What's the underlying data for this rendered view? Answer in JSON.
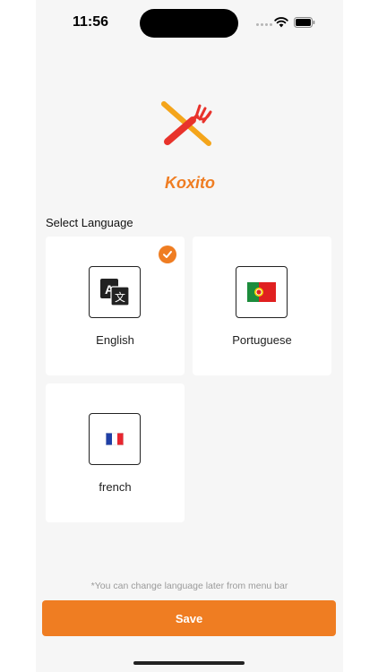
{
  "status_bar": {
    "time": "11:56"
  },
  "brand": {
    "name": "Koxito"
  },
  "section": {
    "title": "Select Language"
  },
  "languages": [
    {
      "label": "English",
      "icon": "translate-icon",
      "selected": true
    },
    {
      "label": "Portuguese",
      "icon": "portugal-flag-icon",
      "selected": false
    },
    {
      "label": "french",
      "icon": "france-flag-icon",
      "selected": false
    }
  ],
  "hint": "*You can change language later from menu bar",
  "actions": {
    "save_label": "Save"
  },
  "colors": {
    "accent": "#ef7d22",
    "background": "#f6f6f6",
    "logo_red": "#e8322b",
    "logo_orange": "#f4a51b"
  }
}
